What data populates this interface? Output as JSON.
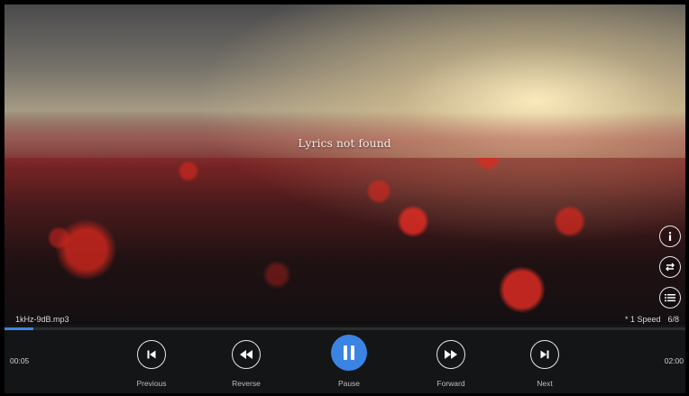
{
  "lyrics": {
    "message": "Lyrics not found"
  },
  "track": {
    "filename": "1kHz-9dB.mp3",
    "elapsed": "00:05",
    "duration": "02:00",
    "progress": 0.042
  },
  "playback": {
    "speed_label": "* 1 Speed",
    "queue_position": "6/8"
  },
  "side_buttons": [
    {
      "icon": "info-icon"
    },
    {
      "icon": "repeat-icon"
    },
    {
      "icon": "playlist-icon"
    }
  ],
  "controls": {
    "previous": {
      "label": "Previous",
      "icon": "skip-previous-icon"
    },
    "reverse": {
      "label": "Reverse",
      "icon": "rewind-icon"
    },
    "pause": {
      "label": "Pause",
      "icon": "pause-icon"
    },
    "forward": {
      "label": "Forward",
      "icon": "fast-forward-icon"
    },
    "next": {
      "label": "Next",
      "icon": "skip-next-icon"
    }
  },
  "colors": {
    "accent": "#3b84e4",
    "bar": "#141516"
  }
}
